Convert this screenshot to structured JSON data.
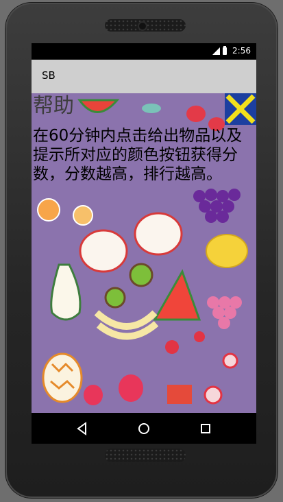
{
  "status_bar": {
    "time": "2:56",
    "icons": [
      "signal-icon",
      "battery-icon"
    ]
  },
  "app_bar": {
    "title": "SB"
  },
  "help": {
    "title": "帮助",
    "body": "在60分钟内点击给出物品以及提示所对应的颜色按钮获得分数，分数越高，排行越高。"
  },
  "close_button": {
    "icon": "close-x-icon",
    "colors": {
      "background": "#1c3fa0",
      "cross": "#f2e01c"
    }
  },
  "background_image": {
    "subject": "fruit-illustration",
    "color": "#8b73ad"
  },
  "nav_bar": {
    "icons": [
      "back-icon",
      "home-icon",
      "recents-icon"
    ]
  }
}
